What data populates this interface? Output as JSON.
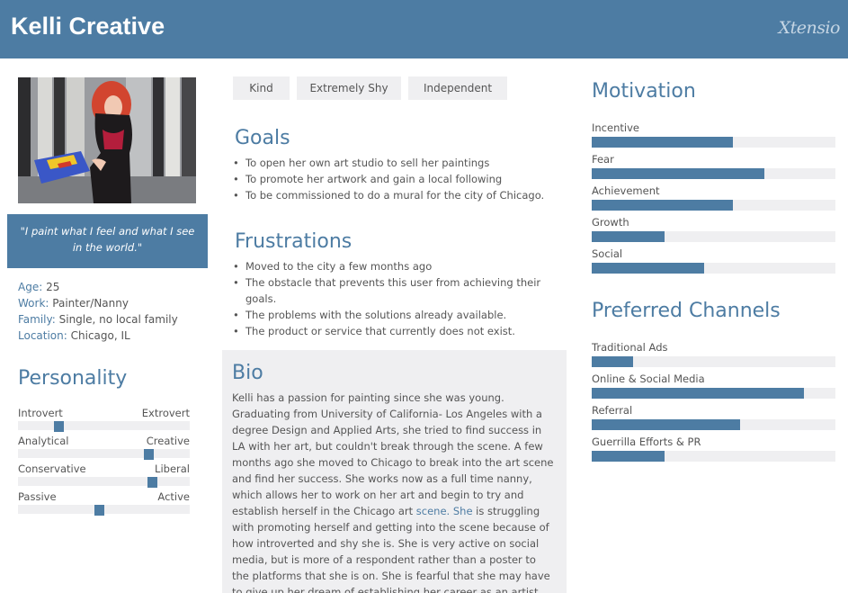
{
  "header": {
    "name": "Kelli Creative",
    "logo": "Xtensio"
  },
  "quote": "\"I paint what I feel and what I see in the world.\"",
  "facts": [
    {
      "key": "Age:",
      "value": "25"
    },
    {
      "key": "Work:",
      "value": "Painter/Nanny"
    },
    {
      "key": "Family:",
      "value": "Single, no local family"
    },
    {
      "key": "Location:",
      "value": "Chicago, IL"
    }
  ],
  "personality": {
    "title": "Personality",
    "traits": [
      {
        "left": "Introvert",
        "right": "Extrovert",
        "level": 0.22
      },
      {
        "left": "Analytical",
        "right": "Creative",
        "level": 0.78
      },
      {
        "left": "Conservative",
        "right": "Liberal",
        "level": 0.8
      },
      {
        "left": "Passive",
        "right": "Active",
        "level": 0.47
      }
    ]
  },
  "tags": [
    "Kind",
    "Extremely Shy",
    "Independent"
  ],
  "goals": {
    "title": "Goals",
    "items": [
      "To open her own art studio to sell her paintings",
      "To promote her artwork and gain a local following",
      "To be commissioned to do a mural for the city of Chicago."
    ]
  },
  "frustrations": {
    "title": "Frustrations",
    "items": [
      "Moved to the city a few months ago",
      "The obstacle that prevents this user from achieving their goals.",
      "The problems with the solutions already available.",
      "The product or service that currently does not exist."
    ]
  },
  "bio": {
    "title": "Bio",
    "text_before": "Kelli has a passion for painting since she was young. Graduating from University of California- Los Angeles with a degree Design and Applied Arts, she tried to find success in LA with her art, but couldn't break through the scene. A few months ago she  moved to Chicago to break into the art scene and find her success. She works now as a full time nanny, which allows her to work on her art and begin to try and establish herself in the Chicago art ",
    "text_link": "scene. She",
    "text_after": " is struggling with promoting herself and getting into the scene because of how introverted and shy she is. She is very active on social media, but is more of a respondent rather than a poster to the platforms that she is on. She is fearful that she may have to give up her dream of establishing her career as an artist."
  },
  "motivation": {
    "title": "Motivation",
    "items": [
      {
        "label": "Incentive",
        "level": 0.58
      },
      {
        "label": "Fear",
        "level": 0.71
      },
      {
        "label": "Achievement",
        "level": 0.58
      },
      {
        "label": "Growth",
        "level": 0.3
      },
      {
        "label": "Social",
        "level": 0.46
      }
    ]
  },
  "channels": {
    "title": "Preferred Channels",
    "items": [
      {
        "label": "Traditional Ads",
        "level": 0.17
      },
      {
        "label": "Online & Social Media",
        "level": 0.87
      },
      {
        "label": "Referral",
        "level": 0.61
      },
      {
        "label": "Guerrilla Efforts & PR",
        "level": 0.3
      }
    ]
  },
  "colors": {
    "accent": "#4d7ca3",
    "track": "#efeff1"
  }
}
